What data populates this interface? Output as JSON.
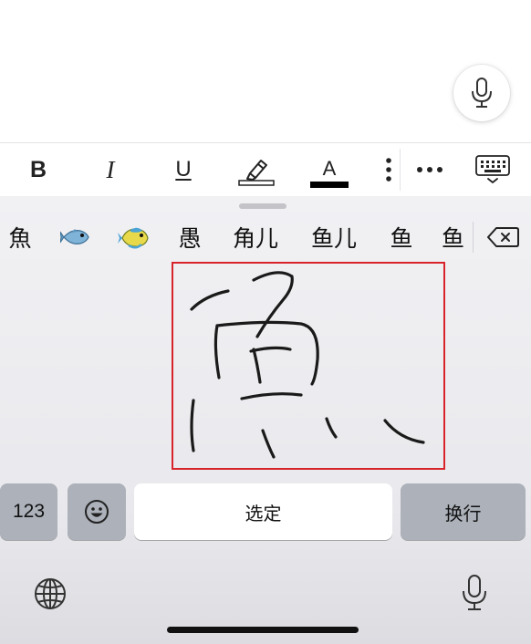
{
  "toolbar": {
    "bold_label": "B",
    "italic_label": "I",
    "underline_label": "U",
    "font_color_label": "A"
  },
  "candidates": {
    "items": [
      "魚",
      "🐟",
      "🐠",
      "愚",
      "角儿",
      "鱼儿",
      "鱼",
      "鱼"
    ]
  },
  "keyboard": {
    "numbers_label": "123",
    "space_label": "选定",
    "return_label": "换行"
  },
  "colors": {
    "handwriting_box_border": "#d8232a",
    "font_color_bar": "#000000",
    "function_key": "#acb1ba"
  }
}
